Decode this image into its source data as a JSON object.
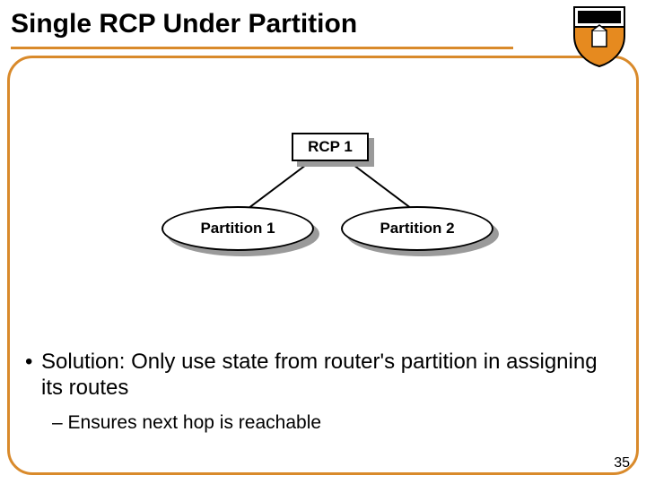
{
  "title": "Single RCP Under Partition",
  "diagram": {
    "rcp_label": "RCP 1",
    "partition1_label": "Partition 1",
    "partition2_label": "Partition 2"
  },
  "bullet": {
    "marker": "•",
    "text": "Solution: Only use state from router's partition in assigning its routes"
  },
  "subbullet": {
    "marker": "–",
    "text": "Ensures next hop is reachable"
  },
  "page_number": "35",
  "logo_alt": "princeton-shield"
}
